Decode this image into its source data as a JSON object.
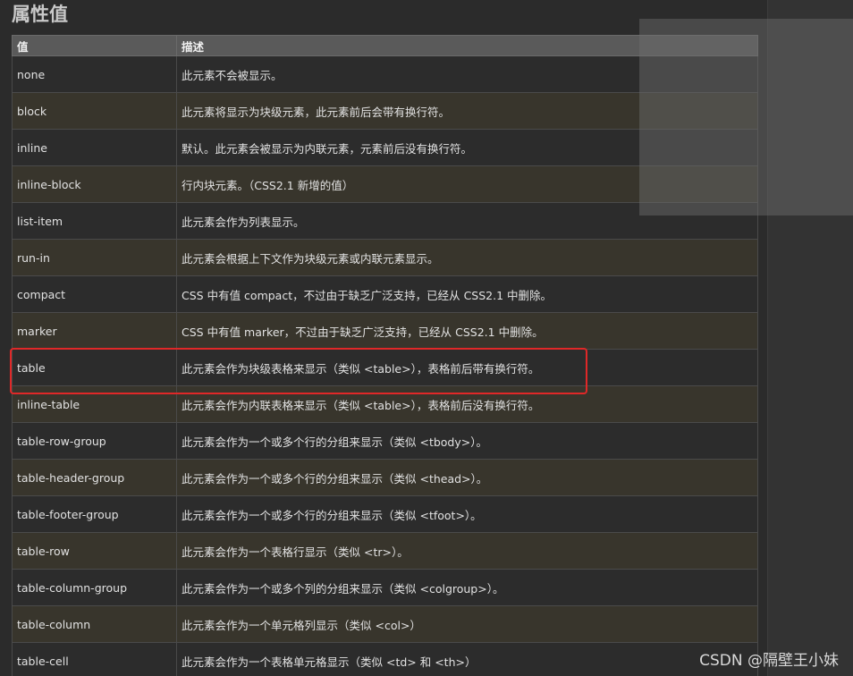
{
  "heading": "属性值",
  "table": {
    "headers": [
      "值",
      "描述"
    ],
    "rows": [
      {
        "value": "none",
        "desc": "此元素不会被显示。"
      },
      {
        "value": "block",
        "desc": "此元素将显示为块级元素，此元素前后会带有换行符。"
      },
      {
        "value": "inline",
        "desc": "默认。此元素会被显示为内联元素，元素前后没有换行符。"
      },
      {
        "value": "inline-block",
        "desc": "行内块元素。（CSS2.1 新增的值）"
      },
      {
        "value": "list-item",
        "desc": "此元素会作为列表显示。"
      },
      {
        "value": "run-in",
        "desc": "此元素会根据上下文作为块级元素或内联元素显示。"
      },
      {
        "value": "compact",
        "desc": "CSS 中有值 compact，不过由于缺乏广泛支持，已经从 CSS2.1 中删除。"
      },
      {
        "value": "marker",
        "desc": "CSS 中有值 marker，不过由于缺乏广泛支持，已经从 CSS2.1 中删除。"
      },
      {
        "value": "table",
        "desc": "此元素会作为块级表格来显示（类似 <table>），表格前后带有换行符。"
      },
      {
        "value": "inline-table",
        "desc": "此元素会作为内联表格来显示（类似 <table>），表格前后没有换行符。"
      },
      {
        "value": "table-row-group",
        "desc": "此元素会作为一个或多个行的分组来显示（类似 <tbody>）。"
      },
      {
        "value": "table-header-group",
        "desc": "此元素会作为一个或多个行的分组来显示（类似 <thead>）。"
      },
      {
        "value": "table-footer-group",
        "desc": "此元素会作为一个或多个行的分组来显示（类似 <tfoot>）。"
      },
      {
        "value": "table-row",
        "desc": "此元素会作为一个表格行显示（类似 <tr>）。"
      },
      {
        "value": "table-column-group",
        "desc": "此元素会作为一个或多个列的分组来显示（类似 <colgroup>）。"
      },
      {
        "value": "table-column",
        "desc": "此元素会作为一个单元格列显示（类似 <col>）"
      },
      {
        "value": "table-cell",
        "desc": "此元素会作为一个表格单元格显示（类似 <td> 和 <th>）"
      }
    ]
  },
  "watermark": "CSDN @隔壁王小妹",
  "colors": {
    "highlight_border": "#e02828",
    "header_bg": "#5a5a5a",
    "row_odd": "#2c2c2c",
    "row_even": "#38352c"
  }
}
